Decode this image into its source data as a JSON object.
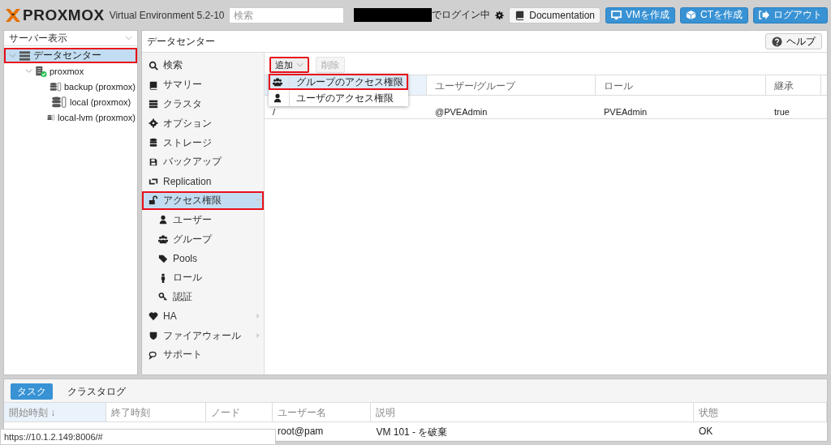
{
  "header": {
    "logo": "PROXMOX",
    "version": "Virtual Environment 5.2-10",
    "search": {
      "placeholder": "検索"
    },
    "login_text": "でログイン中",
    "buttons": [
      {
        "label": "Documentation",
        "kind": "doc"
      },
      {
        "label": "VMを作成",
        "kind": "vm"
      },
      {
        "label": "CTを作成",
        "kind": "ct"
      },
      {
        "label": "ログアウト",
        "kind": "logout"
      }
    ]
  },
  "sidebar": {
    "view_select": "サーバー表示",
    "tree": [
      {
        "label": "データセンター",
        "kind": "datacenter",
        "selected": true,
        "highlighted": true,
        "expanded": true,
        "children": [
          {
            "label": "proxmox",
            "kind": "node",
            "selected": false,
            "highlighted": false,
            "expanded": true,
            "children": [
              {
                "label": "backup (proxmox)",
                "kind": "storage",
                "selected": false,
                "highlighted": false
              },
              {
                "label": "local (proxmox)",
                "kind": "storage",
                "selected": false,
                "highlighted": false
              },
              {
                "label": "local-lvm (proxmox)",
                "kind": "storage",
                "selected": false,
                "highlighted": false
              }
            ]
          }
        ]
      }
    ]
  },
  "content": {
    "title": "データセンター",
    "help_button": "ヘルプ",
    "nav": [
      {
        "label": "検索",
        "selected": false,
        "highlighted": false
      },
      {
        "label": "サマリー",
        "selected": false,
        "highlighted": false
      },
      {
        "label": "クラスタ",
        "selected": false,
        "highlighted": false
      },
      {
        "label": "オプション",
        "selected": false,
        "highlighted": false
      },
      {
        "label": "ストレージ",
        "selected": false,
        "highlighted": false
      },
      {
        "label": "バックアップ",
        "selected": false,
        "highlighted": false
      },
      {
        "label": "Replication",
        "selected": false,
        "highlighted": false
      },
      {
        "label": "アクセス権限",
        "selected": true,
        "highlighted": true,
        "expanded": true,
        "children": [
          {
            "label": "ユーザー",
            "selected": false,
            "highlighted": false
          },
          {
            "label": "グループ",
            "selected": false,
            "highlighted": false
          },
          {
            "label": "Pools",
            "selected": false,
            "highlighted": false
          },
          {
            "label": "ロール",
            "selected": false,
            "highlighted": false
          },
          {
            "label": "認証",
            "selected": false,
            "highlighted": false
          }
        ]
      },
      {
        "label": "HA",
        "selected": false,
        "highlighted": false,
        "expanded": false
      },
      {
        "label": "ファイアウォール",
        "selected": false,
        "highlighted": false,
        "expanded": false
      },
      {
        "label": "サポート",
        "selected": false,
        "highlighted": false
      }
    ],
    "toolbar": [
      {
        "label": "追加",
        "disabled": false,
        "highlighted": true,
        "dropdown": true
      },
      {
        "label": "削除",
        "disabled": true,
        "highlighted": false,
        "dropdown": false
      }
    ],
    "add_menu": [
      {
        "label": "グループのアクセス権限",
        "kind": "group",
        "selected": true,
        "highlighted": true
      },
      {
        "label": "ユーザのアクセス権限",
        "kind": "user",
        "selected": false,
        "highlighted": false
      }
    ],
    "table": {
      "columns": [
        "",
        "ユーザー/グループ",
        "ロール",
        "継承"
      ],
      "rows": [
        [
          "/",
          "@PVEAdmin",
          "PVEAdmin",
          "true"
        ]
      ]
    }
  },
  "bottom_panel": {
    "tabs": [
      {
        "label": "タスク",
        "selected": true
      },
      {
        "label": "クラスタログ",
        "selected": false
      }
    ],
    "columns": [
      {
        "label": "開始時刻 ↓",
        "sorted": true
      },
      {
        "label": "終了時刻",
        "sorted": false
      },
      {
        "label": "ノード",
        "sorted": false
      },
      {
        "label": "ユーザー名",
        "sorted": false
      },
      {
        "label": "説明",
        "sorted": false
      },
      {
        "label": "状態",
        "sorted": false
      }
    ],
    "rows": [
      [
        "",
        "",
        "",
        "root@pam",
        "VM 101 - を破棄",
        "OK"
      ]
    ]
  },
  "status_url": "https://10.1.2.149:8006/#"
}
